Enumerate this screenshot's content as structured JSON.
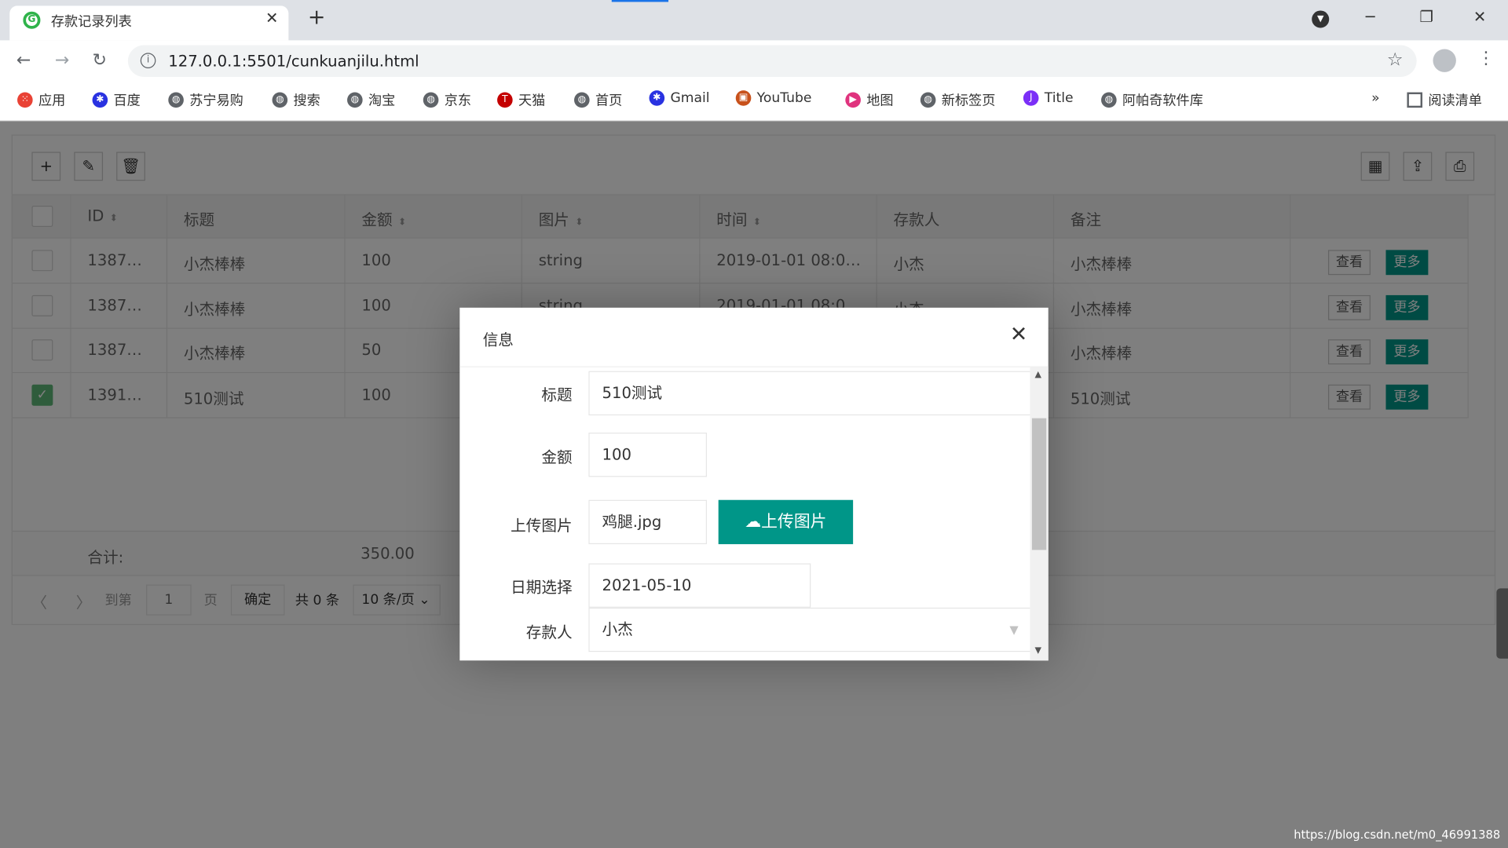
{
  "browser": {
    "tab_title": "存款记录列表",
    "url": "127.0.0.1:5501/cunkuanjilu.html",
    "bookmarks": [
      {
        "label": "应用",
        "icon": "apps-grid-icon"
      },
      {
        "label": "百度",
        "icon": "baidu-paw-icon"
      },
      {
        "label": "苏宁易购",
        "icon": "globe-icon"
      },
      {
        "label": "搜索",
        "icon": "globe-icon"
      },
      {
        "label": "淘宝",
        "icon": "globe-icon"
      },
      {
        "label": "京东",
        "icon": "globe-icon"
      },
      {
        "label": "天猫",
        "icon": "tmall-icon"
      },
      {
        "label": "首页",
        "icon": "globe-icon"
      },
      {
        "label": "Gmail",
        "icon": "baidu-paw-icon"
      },
      {
        "label": "YouTube",
        "icon": "youtube-icon"
      },
      {
        "label": "地图",
        "icon": "map-play-icon"
      },
      {
        "label": "新标签页",
        "icon": "globe-icon"
      },
      {
        "label": "Title",
        "icon": "jetbrains-icon"
      },
      {
        "label": "阿帕奇软件库",
        "icon": "globe-icon"
      }
    ],
    "overflow": "»",
    "reading_list": "阅读清单"
  },
  "table": {
    "headers": [
      "ID",
      "标题",
      "金额",
      "图片",
      "时间",
      "存款人",
      "备注"
    ],
    "rows": [
      {
        "id": "1387…",
        "title": "小杰棒棒",
        "amount": "100",
        "image": "string",
        "time": "2019-01-01 08:0…",
        "depositor": "小杰",
        "note": "小杰棒棒",
        "checked": false
      },
      {
        "id": "1387…",
        "title": "小杰棒棒",
        "amount": "100",
        "image": "string",
        "time": "2019-01-01 08:0…",
        "depositor": "小杰",
        "note": "小杰棒棒",
        "checked": false
      },
      {
        "id": "1387…",
        "title": "小杰棒棒",
        "amount": "50",
        "image": "",
        "time": "",
        "depositor": "",
        "note": "小杰棒棒",
        "checked": false
      },
      {
        "id": "1391…",
        "title": "510测试",
        "amount": "100",
        "image": "",
        "time": "",
        "depositor": "",
        "note": "510测试",
        "checked": true
      }
    ],
    "view_label": "查看",
    "more_label": "更多",
    "total_label": "合计:",
    "total_amount": "350.00"
  },
  "pagination": {
    "goto": "到第",
    "page": "1",
    "page_unit": "页",
    "confirm": "确定",
    "total": "共 0 条",
    "per_page": "10 条/页"
  },
  "dialog": {
    "title": "信息",
    "fields": {
      "title_label": "标题",
      "title_value": "510测试",
      "amount_label": "金额",
      "amount_value": "100",
      "upload_label": "上传图片",
      "upload_value": "鸡腿.jpg",
      "upload_button": "上传图片",
      "date_label": "日期选择",
      "date_value": "2021-05-10",
      "depositor_label": "存款人",
      "depositor_value": "小杰"
    }
  },
  "watermark": "https://blog.csdn.net/m0_46991388",
  "colors": {
    "primary": "#009688",
    "checked": "#5FB878"
  }
}
